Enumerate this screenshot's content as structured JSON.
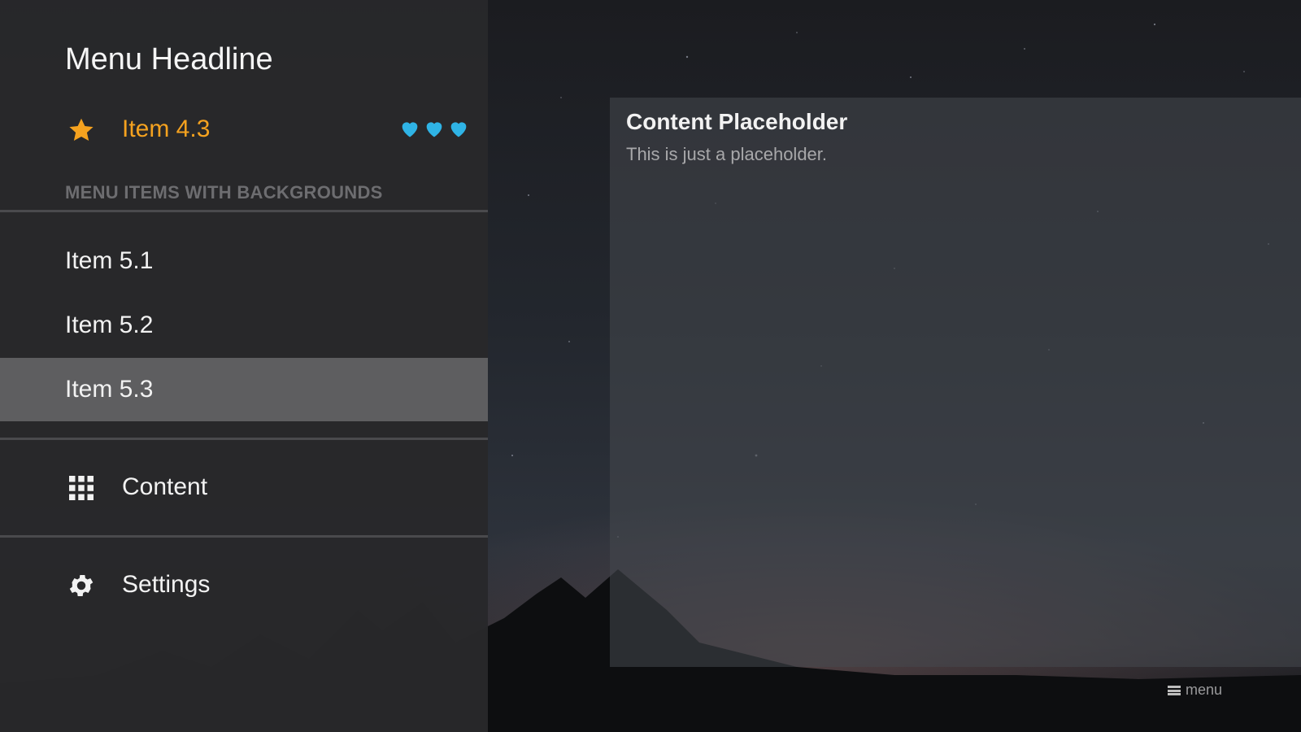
{
  "sidebar": {
    "headline": "Menu Headline",
    "favorite_item": {
      "label": "Item 4.3",
      "icon": "star-icon",
      "hearts": 3,
      "heart_color": "#2fb4e6",
      "label_color": "#f5a21f"
    },
    "section_title": "MENU ITEMS WITH BACKGROUNDS",
    "items": [
      {
        "label": "Item 5.1"
      },
      {
        "label": "Item 5.2"
      },
      {
        "label": "Item 5.3",
        "selected": true
      }
    ],
    "nav": [
      {
        "label": "Content",
        "icon": "grid-icon"
      },
      {
        "label": "Settings",
        "icon": "gear-icon"
      }
    ]
  },
  "content": {
    "title": "Content Placeholder",
    "subtitle": "This is just a placeholder."
  },
  "footer": {
    "menu_hint": "menu"
  }
}
